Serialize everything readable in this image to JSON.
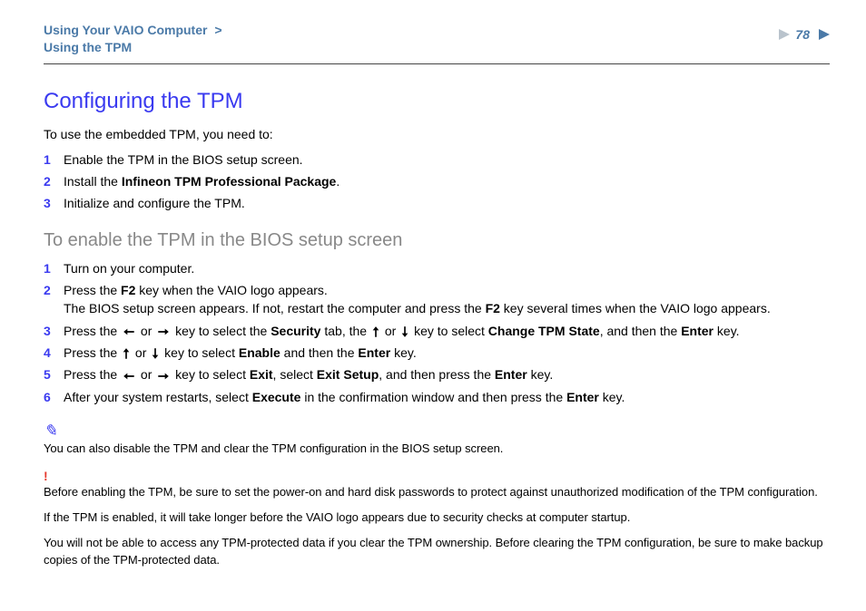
{
  "header": {
    "breadcrumb_chapter": "Using Your VAIO Computer",
    "breadcrumb_section": "Using the TPM",
    "page_number": "78"
  },
  "content": {
    "title": "Configuring the TPM",
    "intro": "To use the embedded TPM, you need to:",
    "steps_a": [
      {
        "num": "1",
        "text": "Enable the TPM in the BIOS setup screen."
      },
      {
        "num": "2",
        "html": "Install the <span class='b'>Infineon TPM Professional Package</span>."
      },
      {
        "num": "3",
        "text": "Initialize and configure the TPM."
      }
    ],
    "subheading": "To enable the TPM in the BIOS setup screen",
    "steps_b": [
      {
        "num": "1",
        "text": "Turn on your computer."
      },
      {
        "num": "2",
        "html": "Press the <span class='b'>F2</span> key when the VAIO logo appears.<br>The BIOS setup screen appears. If not, restart the computer and press the <span class='b'>F2</span> key several times when the VAIO logo appears."
      },
      {
        "num": "3",
        "html": "Press the {{arrow-left}} or {{arrow-right}} key to select the <span class='b'>Security</span> tab, the {{arrow-up}} or {{arrow-down}} key to select <span class='b'>Change TPM State</span>, and then the <span class='b'>Enter</span> key."
      },
      {
        "num": "4",
        "html": "Press the {{arrow-up}} or {{arrow-down}} key to select <span class='b'>Enable</span> and then the <span class='b'>Enter</span> key."
      },
      {
        "num": "5",
        "html": "Press the {{arrow-left}} or {{arrow-right}} key to select <span class='b'>Exit</span>, select <span class='b'>Exit Setup</span>, and then press the <span class='b'>Enter</span> key."
      },
      {
        "num": "6",
        "html": "After your system restarts, select <span class='b'>Execute</span> in the confirmation window and then press the <span class='b'>Enter</span> key."
      }
    ],
    "notes": [
      {
        "icon": "pencil",
        "paras": [
          "You can also disable the TPM and clear the TPM configuration in the BIOS setup screen."
        ]
      },
      {
        "icon": "bang",
        "paras": [
          "Before enabling the TPM, be sure to set the power-on and hard disk passwords to protect against unauthorized modification of the TPM configuration.",
          "If the TPM is enabled, it will take longer before the VAIO logo appears due to security checks at computer startup.",
          "You will not be able to access any TPM-protected data if you clear the TPM ownership. Before clearing the TPM configuration, be sure to make backup copies of the TPM-protected data."
        ]
      }
    ]
  }
}
